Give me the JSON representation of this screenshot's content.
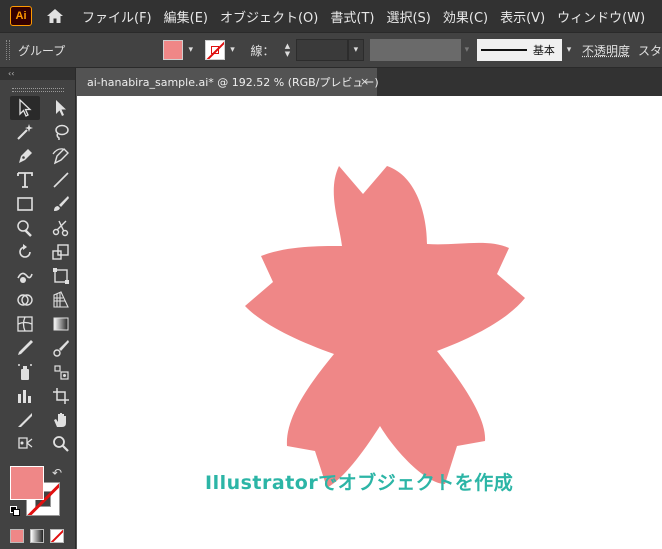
{
  "app": {
    "logo": "Ai",
    "home_icon": "home-icon"
  },
  "menu": [
    "ファイル(F)",
    "編集(E)",
    "オブジェクト(O)",
    "書式(T)",
    "選択(S)",
    "効果(C)",
    "表示(V)",
    "ウィンドウ(W)"
  ],
  "control": {
    "selection_label": "グループ",
    "fill_color": "#ef8787",
    "stroke_label": "線：",
    "stroke_value": "",
    "brush_label": "基本",
    "opacity_label": "不透明度",
    "style_label": "スタ"
  },
  "toolbar": {
    "collapse_label": "‹‹",
    "tools": [
      "selection-tool-icon",
      "direct-selection-tool-icon",
      "magic-wand-tool-icon",
      "lasso-tool-icon",
      "pen-tool-icon",
      "curvature-tool-icon",
      "type-tool-icon",
      "line-tool-icon",
      "rectangle-tool-icon",
      "paintbrush-tool-icon",
      "shaper-tool-icon",
      "scissors-tool-icon",
      "rotate-tool-icon",
      "scale-tool-icon",
      "warp-tool-icon",
      "free-transform-tool-icon",
      "shape-builder-tool-icon",
      "perspective-grid-tool-icon",
      "mesh-tool-icon",
      "gradient-tool-icon",
      "eyedropper-tool-icon",
      "blend-tool-icon",
      "symbol-sprayer-tool-icon",
      "symbol-tool-icon",
      "column-graph-tool-icon",
      "artboard-tool-icon",
      "slice-tool-icon",
      "hand-tool-icon",
      "puppet-warp-tool-icon",
      "zoom-tool-icon"
    ],
    "fill_color": "#ef8787"
  },
  "document": {
    "tab_title": "ai-hanabira_sample.ai* @ 192.52 % (RGB/プレビュー)",
    "close_label": "×"
  },
  "canvas": {
    "shape_color": "#ef8787",
    "caption": "Illustratorでオブジェクトを作成",
    "caption_color": "#2cb5a6"
  }
}
